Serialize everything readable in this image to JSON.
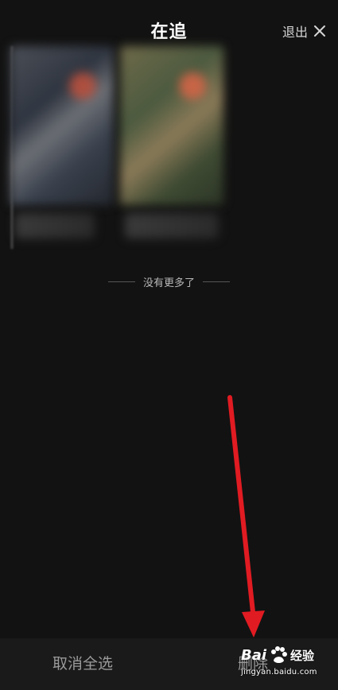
{
  "header": {
    "title": "在追",
    "exit_label": "退出"
  },
  "list": {
    "end_text": "没有更多了"
  },
  "bottom_bar": {
    "cancel_select_label": "取消全选",
    "delete_label": "删除"
  },
  "watermark": {
    "brand": "Bai",
    "brand_suffix": "经验",
    "url": "jingyan.baidu.com"
  },
  "colors": {
    "background": "#121212",
    "bottom_bar": "#1a1a1a",
    "annotation_red": "#e11b22",
    "muted_text": "#9a9a9a"
  },
  "icons": {
    "close": "close-icon",
    "arrow": "red-arrow-annotation",
    "paw": "baidu-paw-icon"
  }
}
